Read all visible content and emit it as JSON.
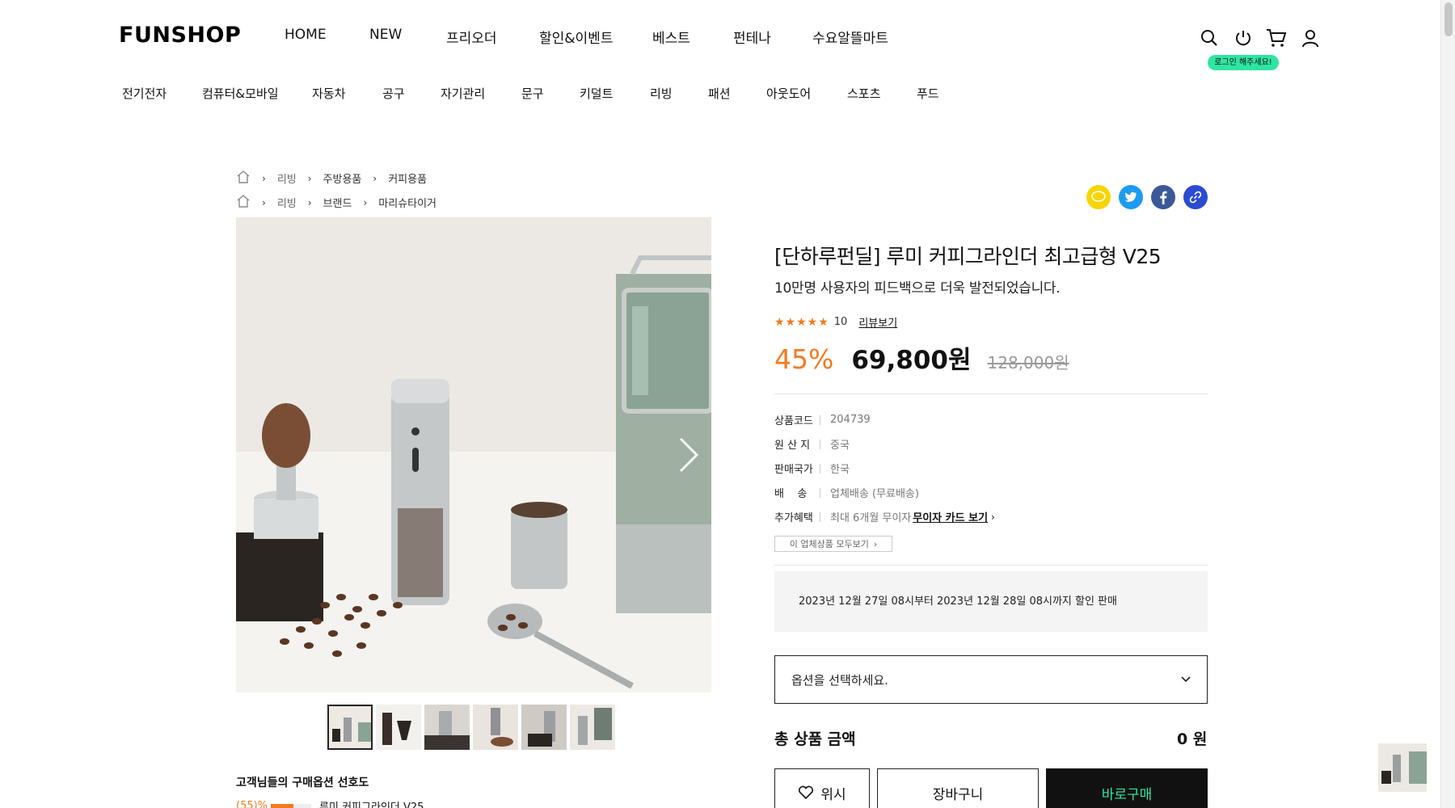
{
  "header": {
    "logo": "FUNSHOP",
    "gnb": [
      "HOME",
      "NEW",
      "프리오더",
      "할인&이벤트",
      "베스트",
      "펀테나",
      "수요알뜰마트"
    ],
    "login_badge": "로그인 해주세요!",
    "categories": [
      "전기전자",
      "컴퓨터&모바일",
      "자동차",
      "공구",
      "자기관리",
      "문구",
      "키덜트",
      "리빙",
      "패션",
      "아웃도어",
      "스포츠",
      "푸드"
    ],
    "icons": [
      "search-icon",
      "power-icon",
      "cart-icon",
      "user-icon"
    ]
  },
  "breadcrumbs": [
    [
      "리빙",
      "주방용품",
      "커피용품"
    ],
    [
      "리빙",
      "브랜드",
      "마리슈타이거"
    ]
  ],
  "share_icons": [
    "kakao-icon",
    "twitter-icon",
    "facebook-icon",
    "link-icon"
  ],
  "product": {
    "title": "[단하루펀딜] 루미 커피그라인더 최고급형 V25",
    "subtitle": "10만명 사용자의 피드백으로 더욱 발전되었습니다.",
    "stars": "★★★★★",
    "rating_count": "10",
    "review_link": "리뷰보기",
    "discount": "45%",
    "price": "69,800원",
    "original_price": "128,000원",
    "info": [
      {
        "key": "상품코드",
        "value": "204739"
      },
      {
        "key": "원 산 지",
        "value": "중국"
      },
      {
        "key": "판매국가",
        "value": "한국"
      },
      {
        "key": "배    송",
        "value": "업체배송 (무료배송)"
      },
      {
        "key": "추가혜택",
        "value": "최대 6개월 무이자",
        "link": "무이자 카드 보기"
      }
    ],
    "all_products_button": "이 업체상품 모두보기",
    "sale_period": "2023년 12월 27일 08시부터 2023년 12월 28일 08시까지 할인 판매",
    "option_placeholder": "옵션을 선택하세요.",
    "total_label": "총 상품 금액",
    "total_value": "0 원",
    "buttons": {
      "wish": "위시",
      "cart": "장바구니",
      "buy": "바로구매"
    }
  },
  "preference": {
    "title": "고객님들의 구매옵션 선호도",
    "percent": "(55)%",
    "option_name": "루미 커피그라인더 V25",
    "fill": 0.55
  },
  "colors": {
    "accent": "#f47a1f",
    "brand_green": "#2ee5a1",
    "kakao": "#f7d500",
    "twitter": "#1d9bf0",
    "facebook": "#3b5998",
    "link": "#2b4bd1"
  }
}
